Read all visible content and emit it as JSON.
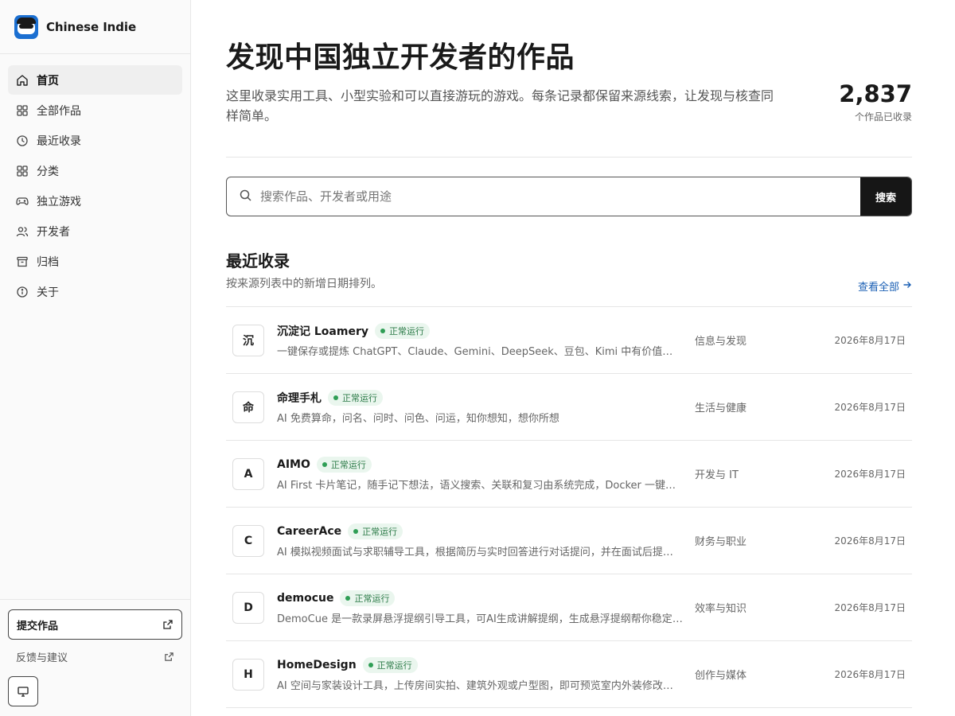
{
  "brand": {
    "name": "Chinese Indie"
  },
  "nav": [
    {
      "label": "首页",
      "icon": "home-icon",
      "active": true
    },
    {
      "label": "全部作品",
      "icon": "grid-icon",
      "active": false
    },
    {
      "label": "最近收录",
      "icon": "clock-icon",
      "active": false
    },
    {
      "label": "分类",
      "icon": "grid-icon",
      "active": false
    },
    {
      "label": "独立游戏",
      "icon": "gamepad-icon",
      "active": false
    },
    {
      "label": "开发者",
      "icon": "users-icon",
      "active": false
    },
    {
      "label": "归档",
      "icon": "archive-icon",
      "active": false
    },
    {
      "label": "关于",
      "icon": "info-icon",
      "active": false
    }
  ],
  "sidebar_bottom": {
    "submit_label": "提交作品",
    "feedback_label": "反馈与建议"
  },
  "hero": {
    "title": "发现中国独立开发者的作品",
    "description": "这里收录实用工具、小型实验和可以直接游玩的游戏。每条记录都保留来源线索，让发现与核查同样简单。",
    "stat_value": "2,837",
    "stat_label": "个作品已收录"
  },
  "search": {
    "placeholder": "搜索作品、开发者或用途",
    "button_label": "搜索"
  },
  "recent": {
    "title": "最近收录",
    "subtitle": "按来源列表中的新增日期排列。",
    "view_all": "查看全部",
    "items": [
      {
        "initial": "沉",
        "name": "沉淀记 Loamery",
        "status": "正常运行",
        "desc": "一键保存或提炼 ChatGPT、Claude、Gemini、DeepSeek、豆包、Kimi 中有价值的回答…",
        "category": "信息与发现",
        "date": "2026年8月17日"
      },
      {
        "initial": "命",
        "name": "命理手札",
        "status": "正常运行",
        "desc": "AI 免费算命，问名、问时、问色、问运，知你想知，想你所想",
        "category": "生活与健康",
        "date": "2026年8月17日"
      },
      {
        "initial": "A",
        "name": "AIMO",
        "status": "正常运行",
        "desc": "AI First 卡片笔记，随手记下想法，语义搜索、关联和复习由系统完成，Docker 一键自…",
        "category": "开发与 IT",
        "date": "2026年8月17日"
      },
      {
        "initial": "C",
        "name": "CareerAce",
        "status": "正常运行",
        "desc": "AI 模拟视频面试与求职辅导工具，根据简历与实时回答进行对话提问，并在面试后提供…",
        "category": "财务与职业",
        "date": "2026年8月17日"
      },
      {
        "initial": "D",
        "name": "democue",
        "status": "正常运行",
        "desc": "DemoCue 是一款录屏悬浮提纲引导工具，可AI生成讲解提纲，生成悬浮提纲帮你稳定完…",
        "category": "效率与知识",
        "date": "2026年8月17日"
      },
      {
        "initial": "H",
        "name": "HomeDesign",
        "status": "正常运行",
        "desc": "AI 空间与家装设计工具，上传房间实拍、建筑外观或户型图，即可预览室内外装修改造…",
        "category": "创作与媒体",
        "date": "2026年8月17日"
      }
    ]
  }
}
